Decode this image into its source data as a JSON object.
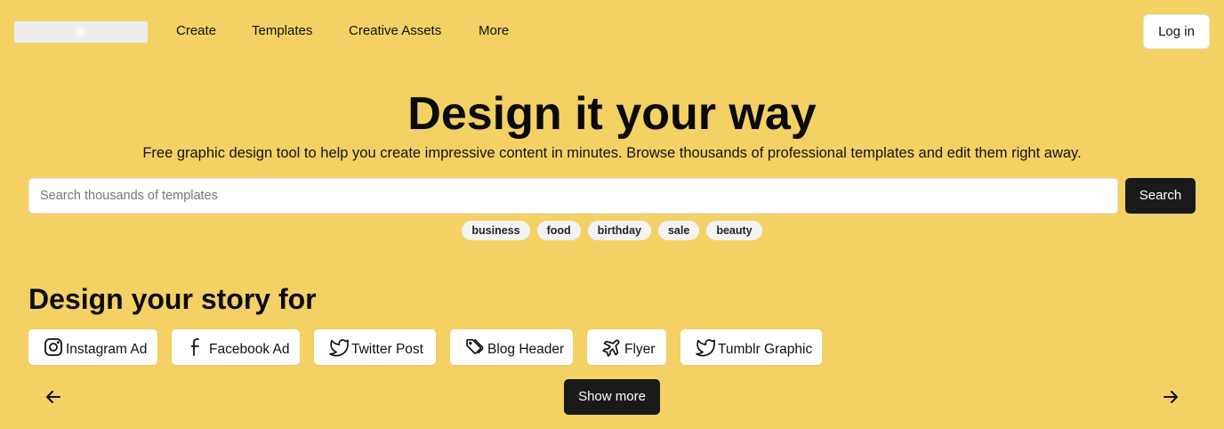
{
  "nav": {
    "links": [
      "Create",
      "Templates",
      "Creative Assets",
      "More"
    ],
    "login_label": "Log in"
  },
  "hero": {
    "title": "Design it your way",
    "subtitle": "Free graphic design tool to help you create impressive content in minutes. Browse thousands of professional templates and edit them right away.",
    "search_placeholder": "Search thousands of templates",
    "search_button": "Search",
    "tags": [
      "business",
      "food",
      "birthday",
      "sale",
      "beauty"
    ]
  },
  "story": {
    "title": "Design your story for",
    "cards": [
      {
        "label": "Instagram Ad",
        "icon": "instagram-icon"
      },
      {
        "label": "Facebook Ad",
        "icon": "facebook-icon"
      },
      {
        "label": "Twitter Post",
        "icon": "twitter-icon"
      },
      {
        "label": "Blog Header",
        "icon": "tags-icon"
      },
      {
        "label": "Flyer",
        "icon": "plane-icon"
      },
      {
        "label": "Tumblr Graphic",
        "icon": "twitter-icon"
      }
    ],
    "show_more": "Show more",
    "prev_icon": "arrow-left-icon",
    "next_icon": "arrow-right-icon"
  },
  "colors": {
    "background": "#f4d165",
    "dark_button": "#1a1a1a",
    "card": "#ffffff"
  }
}
